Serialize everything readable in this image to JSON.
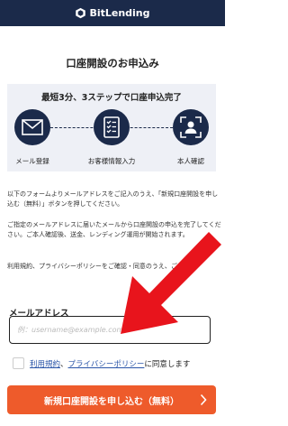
{
  "header": {
    "brand": "BitLending",
    "logo_icon": "bitlending-logo-icon"
  },
  "page_title": "口座開設のお申込み",
  "steps": {
    "title": "最短3分、3ステップで口座申込完了",
    "items": [
      {
        "label": "メール登録",
        "icon": "mail-icon"
      },
      {
        "label": "お客様情報入力",
        "icon": "document-checklist-icon"
      },
      {
        "label": "本人確認",
        "icon": "face-id-icon"
      }
    ]
  },
  "paragraphs": [
    "以下のフォームよりメールアドレスをご記入のうえ、「新規口座開設を申し込む（無料）」ボタンを押してください。",
    "ご指定のメールアドレスに届いたメールから口座開設の申込を完了してください。ご本人確認後、送金、レンディング運用が開始されます。",
    "利用規約、プライバシーポリシーをご確認・同意のうえ、ご..."
  ],
  "email": {
    "label": "メールアドレス",
    "placeholder": "例：username@example.com",
    "value": ""
  },
  "agreement": {
    "terms_link": "利用規約",
    "separator": "、",
    "privacy_link": "プライバシーポリシー",
    "suffix": "に同意します",
    "checked": false
  },
  "submit": {
    "label": "新規口座開設を申し込む（無料）",
    "icon": "chevron-right-icon"
  },
  "colors": {
    "navy": "#1b2a4a",
    "accent": "#ee5b2b",
    "arrow": "#e8141c",
    "link": "#2a55a8",
    "panel": "#eef0f6"
  }
}
